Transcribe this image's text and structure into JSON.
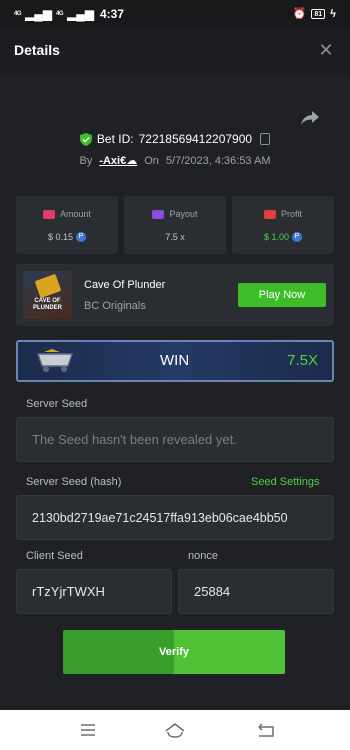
{
  "status_bar": {
    "time": "4:37",
    "net1": "4G",
    "net2": "4G",
    "battery": "81"
  },
  "header": {
    "title": "Details",
    "close_glyph": "✕"
  },
  "bet": {
    "id_label": "Bet ID:",
    "id_value": "72218569412207900",
    "by_label": "By",
    "user": "-Axi€☁",
    "on_label": "On",
    "datetime": "5/7/2023, 4:36:53 AM"
  },
  "stats": {
    "amount_label": "Amount",
    "amount_value": "$ 0.15",
    "payout_label": "Payout",
    "payout_value": "7.5 x",
    "profit_label": "Profit",
    "profit_value": "$ 1.00",
    "coin_glyph": "P"
  },
  "game": {
    "thumb_text": "CAVE OF PLUNDER",
    "name": "Cave Of Plunder",
    "category": "BC Originals",
    "play_label": "Play Now"
  },
  "result": {
    "status": "WIN",
    "multiplier": "7.5X"
  },
  "server_seed": {
    "label": "Server Seed",
    "value": "The Seed hasn't been revealed yet."
  },
  "server_seed_hash": {
    "label": "Server Seed (hash)",
    "settings_link": "Seed Settings",
    "value": "2130bd2719ae71c24517ffa913eb06cae4bb50"
  },
  "client_seed": {
    "label": "Client Seed",
    "value": "rTzYjrTWXH"
  },
  "nonce": {
    "label": "nonce",
    "value": "25884"
  },
  "verify_label": "Verify",
  "colors": {
    "accent_green": "#3fbd29",
    "background": "#1f2124",
    "card": "#2a2d31"
  },
  "icons": [
    "shield-check-icon",
    "copy-icon",
    "share-icon",
    "close-icon",
    "menu-icon",
    "home-icon",
    "back-icon"
  ]
}
